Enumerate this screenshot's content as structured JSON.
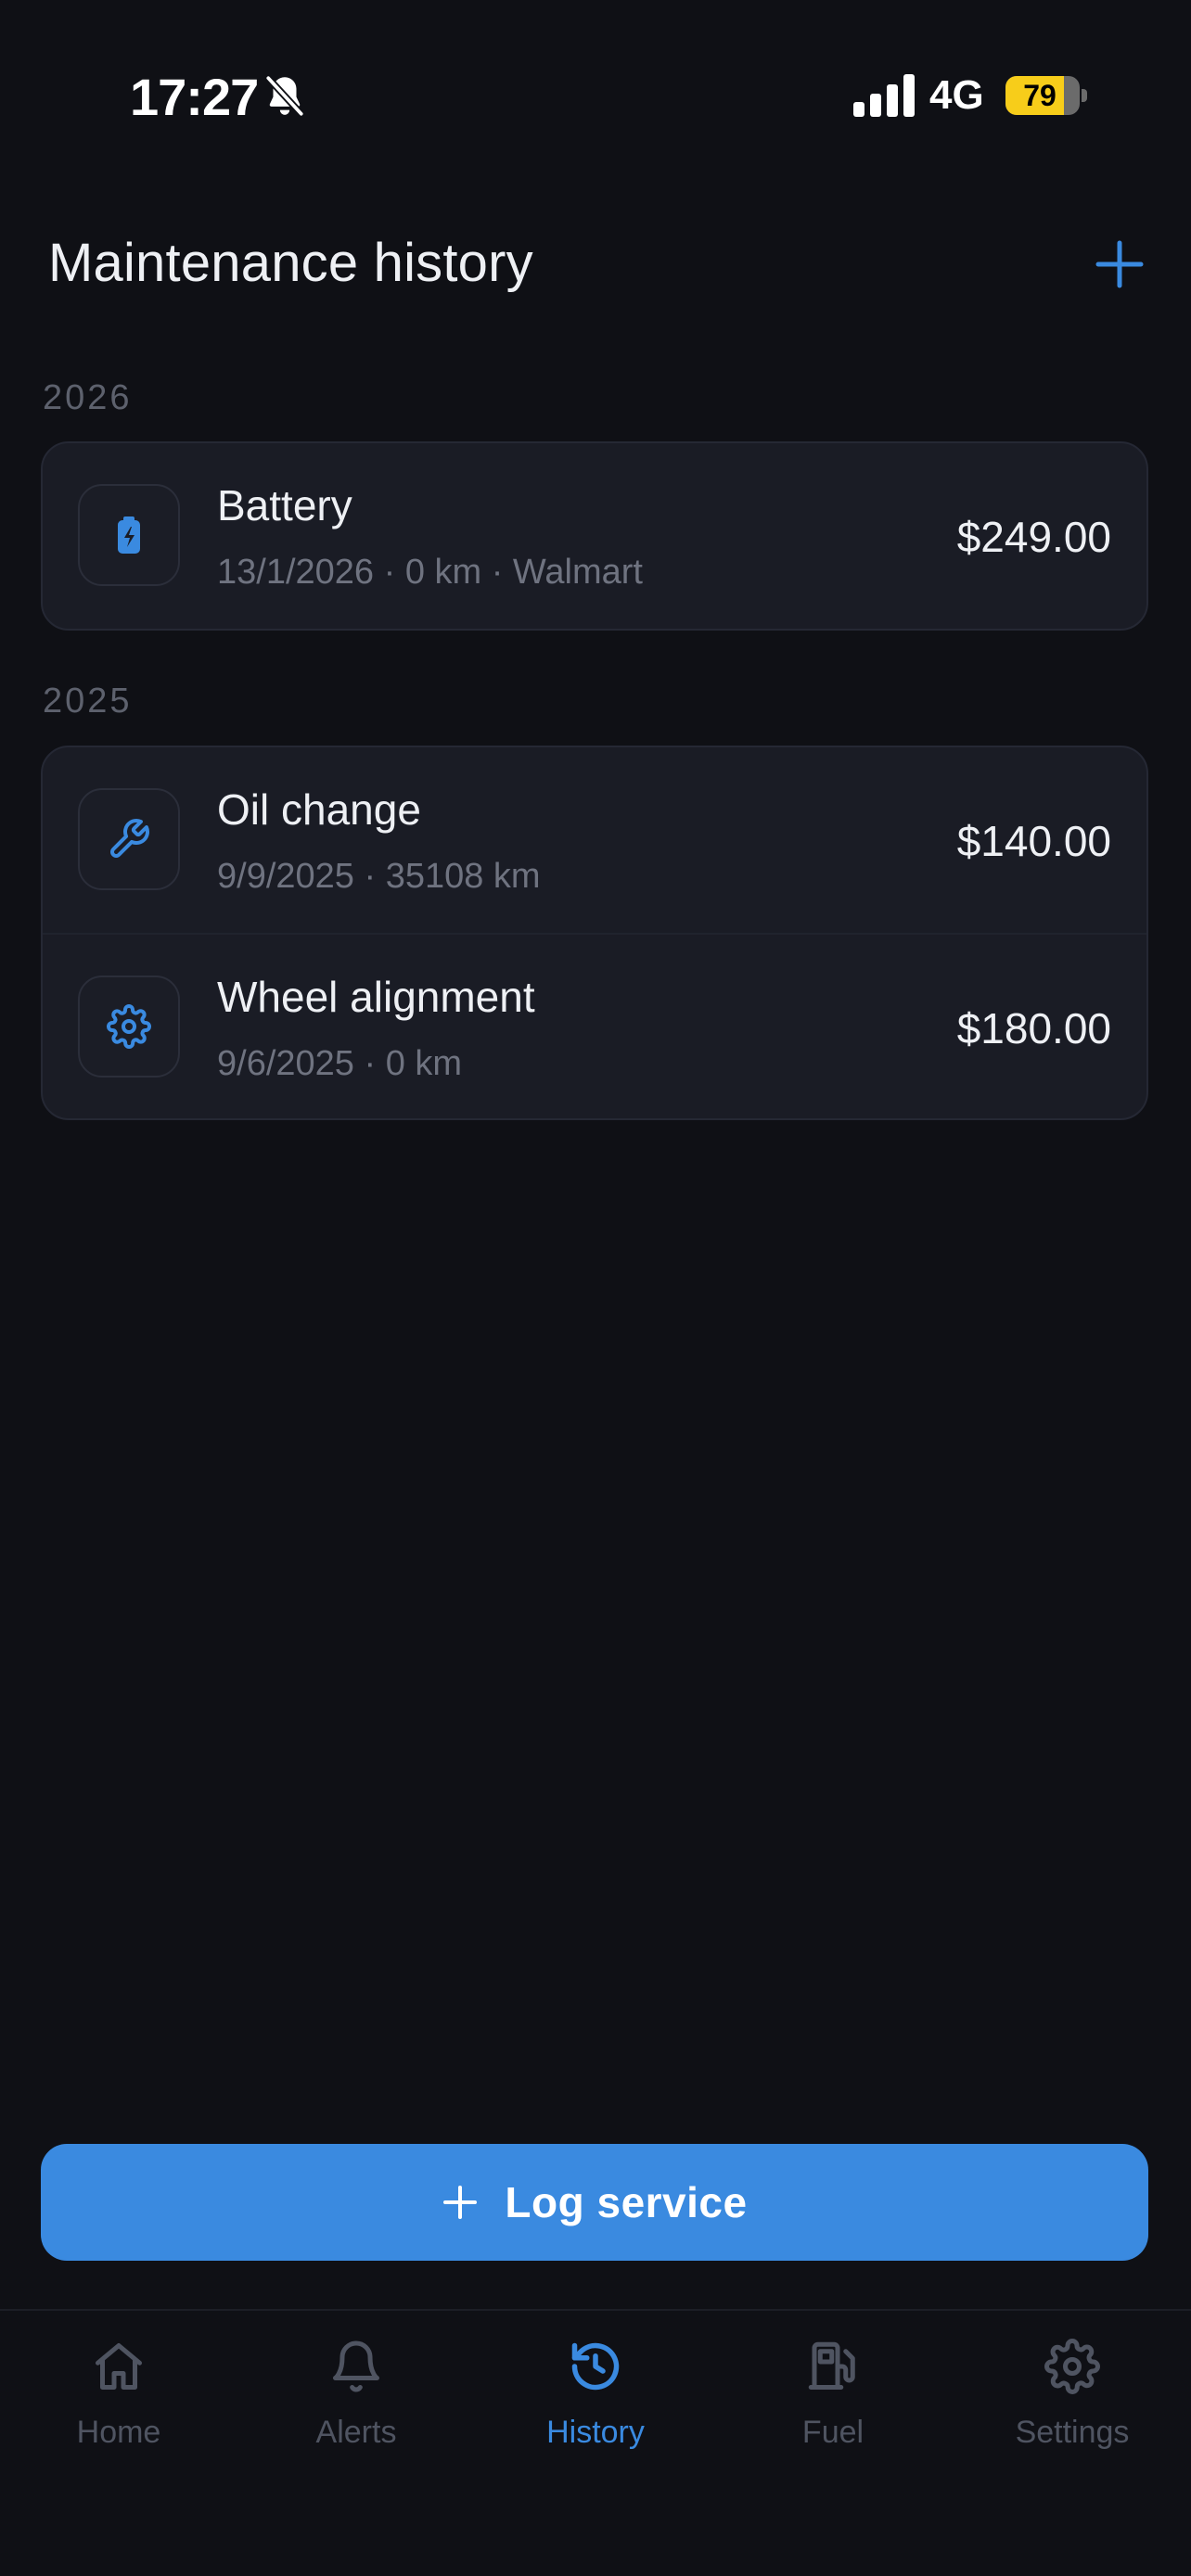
{
  "status_bar": {
    "time": "17:27",
    "network": "4G",
    "battery_percent": "79",
    "battery_level": 0.79
  },
  "header": {
    "title": "Maintenance history"
  },
  "sections": [
    {
      "year": "2026",
      "items": [
        {
          "icon": "battery-charging-icon",
          "title": "Battery",
          "subtitle": "13/1/2026 · 0 km · Walmart",
          "amount": "$249.00"
        }
      ]
    },
    {
      "year": "2025",
      "items": [
        {
          "icon": "wrench-icon",
          "title": "Oil change",
          "subtitle": "9/9/2025 · 35108 km",
          "amount": "$140.00"
        },
        {
          "icon": "gear-icon",
          "title": "Wheel alignment",
          "subtitle": "9/6/2025 · 0 km",
          "amount": "$180.00"
        }
      ]
    }
  ],
  "actions": {
    "log_service_label": "Log service"
  },
  "tabs": [
    {
      "label": "Home",
      "icon": "home-icon",
      "active": false
    },
    {
      "label": "Alerts",
      "icon": "bell-icon",
      "active": false
    },
    {
      "label": "History",
      "icon": "history-icon",
      "active": true
    },
    {
      "label": "Fuel",
      "icon": "fuel-pump-icon",
      "active": false
    },
    {
      "label": "Settings",
      "icon": "gear-icon",
      "active": false
    }
  ],
  "colors": {
    "background": "#0f1015",
    "card": "#1a1c25",
    "accent": "#3a8ae0",
    "muted_text": "#6f7380",
    "inactive_tab": "#4f5461",
    "battery_fill": "#f7cd1a"
  }
}
